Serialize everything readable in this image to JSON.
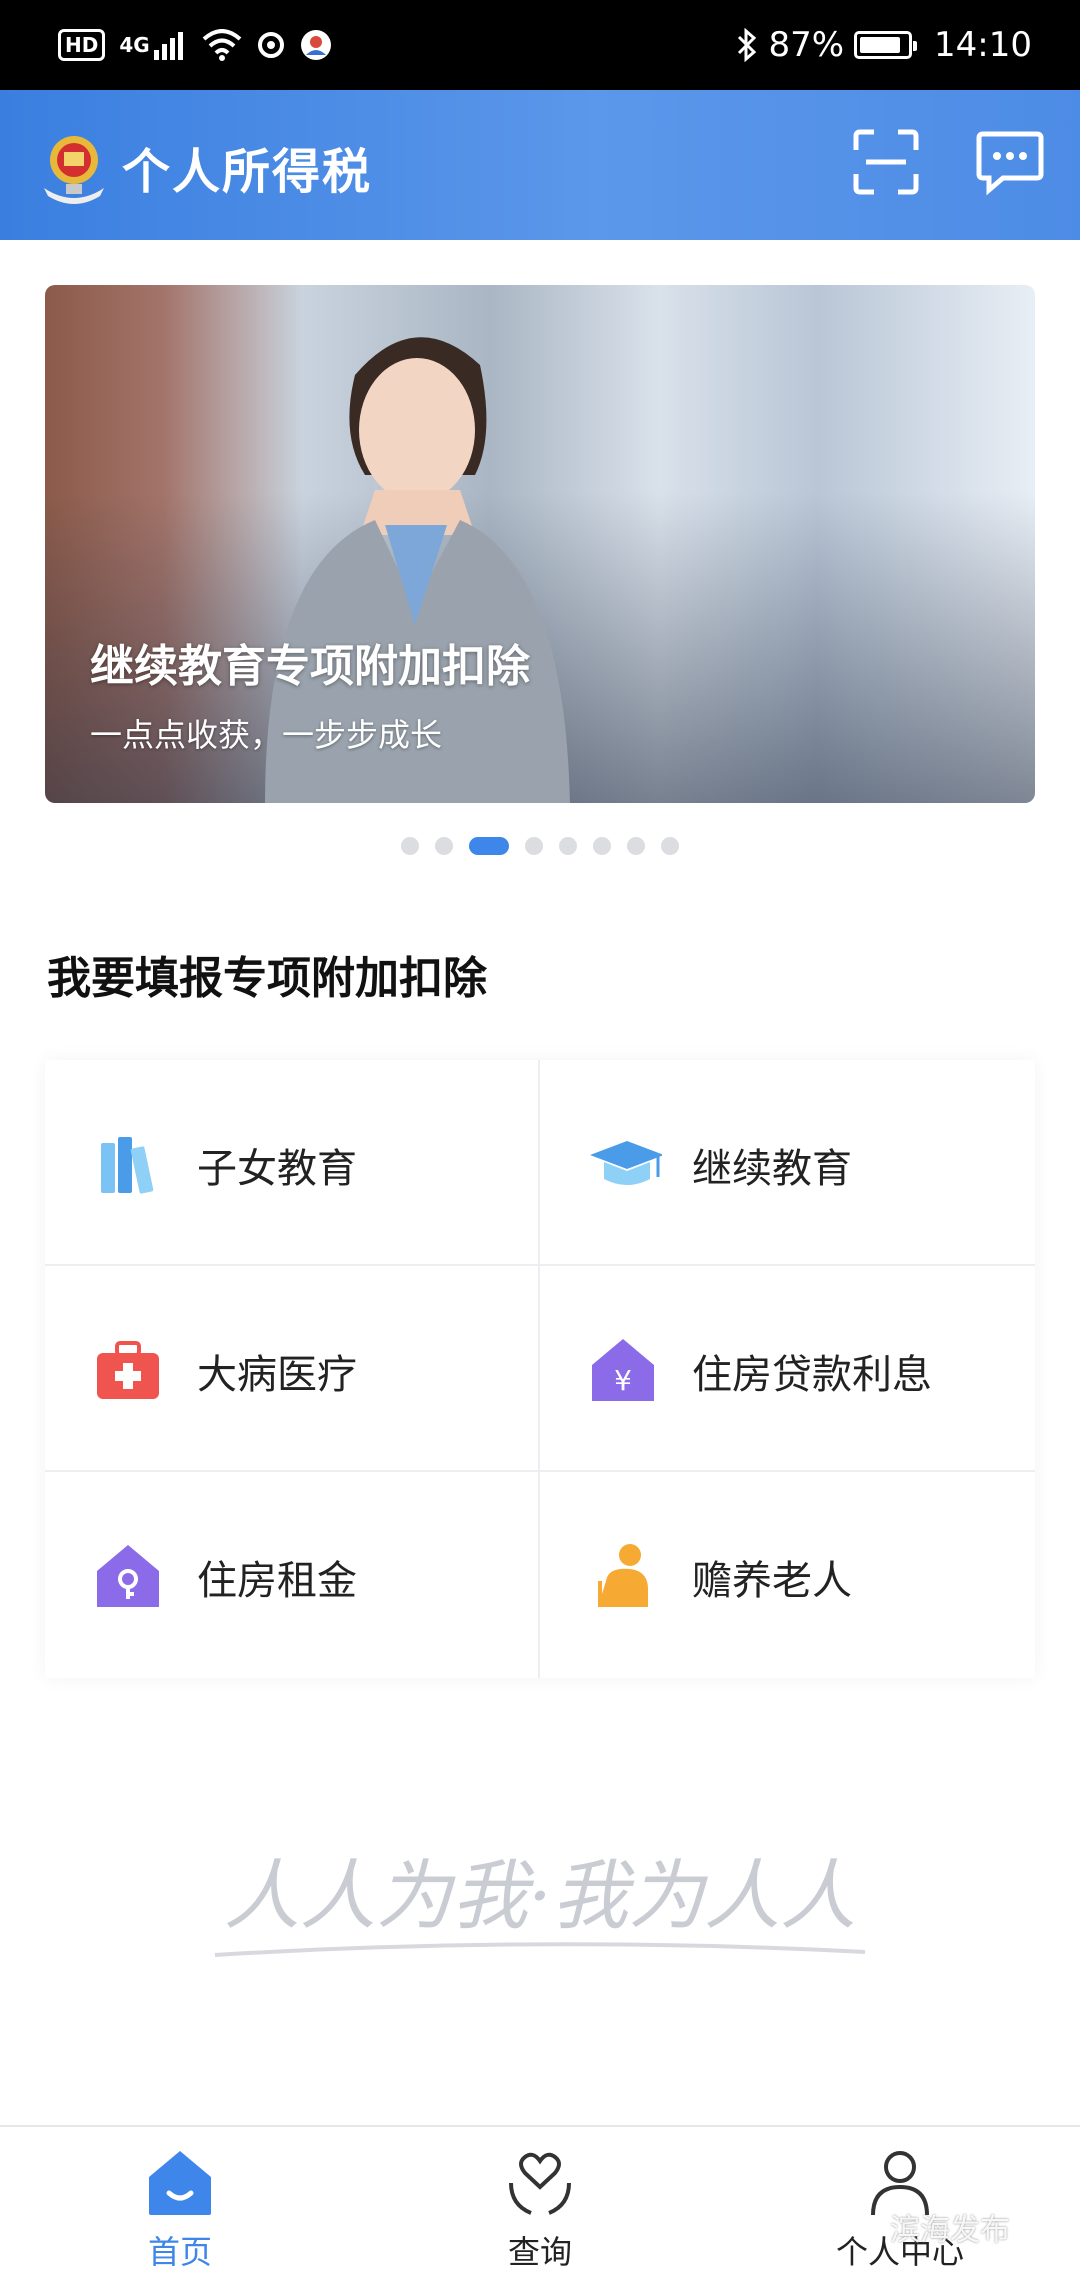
{
  "status_bar": {
    "badge": "HD",
    "network": "4G",
    "battery": "87%",
    "battery_level": 0.87,
    "time": "14:10"
  },
  "app_bar": {
    "title": "个人所得税",
    "icons": [
      "emblem-icon",
      "scan-icon",
      "message-icon"
    ]
  },
  "banner": {
    "title": "继续教育专项附加扣除",
    "subtitle": "一点点收获，一步步成长",
    "slide_count": 8,
    "active_slide": 3
  },
  "section": {
    "title": "我要填报专项附加扣除"
  },
  "deductions": [
    {
      "label": "子女教育",
      "icon": "books-icon",
      "color": "#5aa8ef"
    },
    {
      "label": "继续教育",
      "icon": "graduation-cap-icon",
      "color": "#4a9be8"
    },
    {
      "label": "大病医疗",
      "icon": "medical-kit-icon",
      "color": "#f0544f"
    },
    {
      "label": "住房贷款利息",
      "icon": "house-yuan-icon",
      "color": "#8b6be8"
    },
    {
      "label": "住房租金",
      "icon": "house-key-icon",
      "color": "#8b6be8"
    },
    {
      "label": "赡养老人",
      "icon": "elder-icon",
      "color": "#f6a933"
    }
  ],
  "slogan": "人人为我·我为人人",
  "bottom_nav": [
    {
      "label": "首页",
      "icon": "home-icon",
      "active": true
    },
    {
      "label": "查询",
      "icon": "heart-hands-icon",
      "active": false
    },
    {
      "label": "个人中心",
      "icon": "person-icon",
      "active": false
    }
  ],
  "watermark": "滨海发布",
  "colors": {
    "accent": "#3f86ea",
    "app_bar": "#4a8be6",
    "status_bar": "#000000"
  }
}
